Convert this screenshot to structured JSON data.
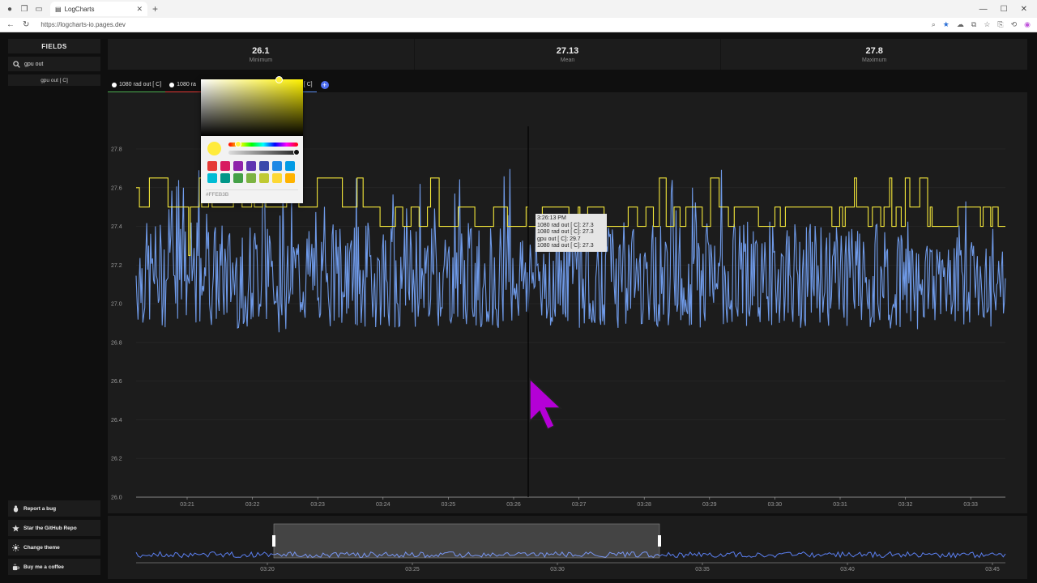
{
  "browser": {
    "tab_title": "LogCharts",
    "url": "https://logcharts-io.pages.dev"
  },
  "sidebar": {
    "fields_title": "FIELDS",
    "search_value": "gpu out",
    "field_items": [
      "gpu out [ C]"
    ],
    "bottom_buttons": [
      {
        "label": "Report a bug",
        "icon": "bug-icon"
      },
      {
        "label": "Star the GitHub Repo",
        "icon": "star-icon"
      },
      {
        "label": "Change theme",
        "icon": "sun-icon"
      },
      {
        "label": "Buy me a coffee",
        "icon": "coffee-icon"
      }
    ]
  },
  "stats": [
    {
      "value": "26.1",
      "label": "Minimum"
    },
    {
      "value": "27.13",
      "label": "Mean"
    },
    {
      "value": "27.8",
      "label": "Maximum"
    }
  ],
  "series_tabs": [
    {
      "label": "1080 rad out [ C]",
      "color": "#4caf50"
    },
    {
      "label": "1080 ra",
      "color": "#e53935"
    },
    {
      "label": "0 rad out [ C]",
      "color": "#5b8ff0"
    }
  ],
  "color_picker": {
    "hex_value": "#FFEB3B",
    "swatches": [
      "#e53935",
      "#d81b60",
      "#8e24aa",
      "#5e35b1",
      "#3949ab",
      "#1e88e5",
      "#039be5",
      "#00bcd4",
      "#009688",
      "#43a047",
      "#7cb342",
      "#c0ca33",
      "#fdd835",
      "#ffb300"
    ]
  },
  "tooltip": {
    "time": "3:26:13 PM",
    "lines": [
      "1080 rad out [ C]: 27.3",
      "1080 rad out [ C]: 27.3",
      "gpu out [ C]: 29.7",
      "1080 rad out [ C]: 27.3"
    ]
  },
  "chart_data": {
    "type": "line",
    "y_ticks": [
      "26.0",
      "26.2",
      "26.4",
      "26.6",
      "26.8",
      "27.0",
      "27.2",
      "27.4",
      "27.6",
      "27.8"
    ],
    "ylim": [
      26.0,
      27.9
    ],
    "x_ticks": [
      "03:21",
      "03:22",
      "03:23",
      "03:24",
      "03:25",
      "03:26",
      "03:27",
      "03:28",
      "03:29",
      "03:30",
      "03:31",
      "03:32",
      "03:33"
    ],
    "crosshair_time": "03:26:13",
    "grid": true,
    "series": [
      {
        "color": "#f5e83a",
        "levels": [
          27.4,
          27.5,
          27.65
        ],
        "baseline": 27.5
      },
      {
        "color": "#6f9ae8",
        "mean": 27.15,
        "min": 26.7,
        "max": 27.7
      }
    ],
    "navigator_ticks": [
      "03:20",
      "03:25",
      "03:30",
      "03:35",
      "03:40",
      "03:45"
    ]
  },
  "colors": {
    "yellow_series": "#f5e83a",
    "blue_series": "#6f9ae8",
    "accent": "#4f6ff0",
    "cursor": "#b400d6"
  }
}
